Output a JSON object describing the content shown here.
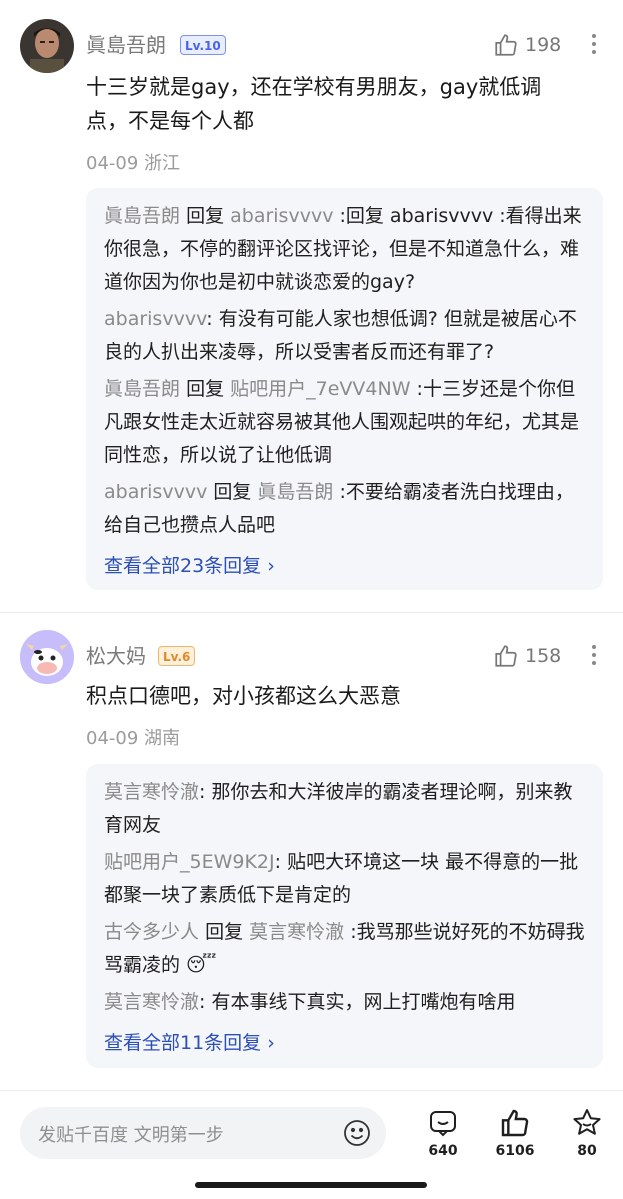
{
  "comments": [
    {
      "username": "眞島吾朗",
      "level": "Lv.10",
      "likes": "198",
      "text": "十三岁就是gay，还在学校有男朋友，gay就低调点，不是每个人都",
      "meta": "04-09 浙江",
      "replies": [
        {
          "user": "眞島吾朗",
          "reply_word": "回复",
          "target": "abarisvvvv",
          "text": ":回复 abarisvvvv :看得出来你很急，不停的翻评论区找评论，但是不知道急什么，难道你因为你也是初中就谈恋爱的gay?"
        },
        {
          "user": "abarisvvvv",
          "reply_word": "",
          "target": "",
          "text": ": 有没有可能人家也想低调? 但就是被居心不良的人扒出来凌辱，所以受害者反而还有罪了?"
        },
        {
          "user": "眞島吾朗",
          "reply_word": "回复",
          "target": "贴吧用户_7eVV4NW",
          "text": ":十三岁还是个你但凡跟女性走太近就容易被其他人围观起哄的年纪，尤其是同性恋，所以说了让他低调"
        },
        {
          "user": "abarisvvvv",
          "reply_word": "回复",
          "target": "眞島吾朗",
          "text": ":不要给霸凌者洗白找理由，给自己也攒点人品吧"
        }
      ],
      "view_all": "查看全部23条回复 ›"
    },
    {
      "username": "松大妈",
      "level": "Lv.6",
      "likes": "158",
      "text": "积点口德吧，对小孩都这么大恶意",
      "meta": "04-09 湖南",
      "replies": [
        {
          "user": "莫言寒怜澈",
          "reply_word": "",
          "target": "",
          "text": ": 那你去和大洋彼岸的霸凌者理论啊，别来教育网友"
        },
        {
          "user": "贴吧用户_5EW9K2J",
          "reply_word": "",
          "target": "",
          "text": ": 贴吧大环境这一块 最不得意的一批都聚一块了素质低下是肯定的"
        },
        {
          "user": "古今多少人",
          "reply_word": "回复",
          "target": "莫言寒怜澈",
          "text": ":我骂那些说好死的不妨碍我骂霸凌的 😴"
        },
        {
          "user": "莫言寒怜澈",
          "reply_word": "",
          "target": "",
          "text": ": 有本事线下真实，网上打嘴炮有啥用"
        }
      ],
      "view_all": "查看全部11条回复 ›"
    }
  ],
  "bottom": {
    "placeholder": "发贴千百度 文明第一步",
    "comments_count": "640",
    "likes_count": "6106",
    "favorites_count": "80"
  },
  "colors": {
    "link": "#2a4fb8",
    "username": "#7a7a7a",
    "reply_bg": "#f5f6f9"
  }
}
